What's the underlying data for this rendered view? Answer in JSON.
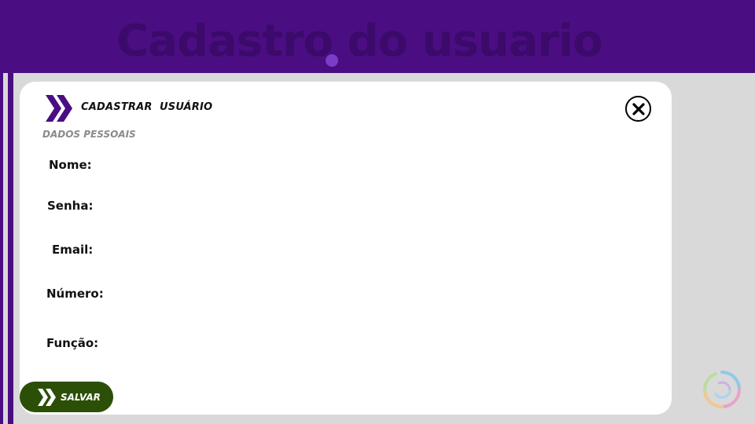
{
  "header": {
    "title": "Cadastro do usuario"
  },
  "card": {
    "title": "CADASTRAR  USUÁRIO",
    "section_label": "DADOS PESSOAIS"
  },
  "fields": [
    {
      "label": "Nome:",
      "value": ""
    },
    {
      "label": "Senha:",
      "value": ""
    },
    {
      "label": "Email:",
      "value": ""
    },
    {
      "label": "Número:",
      "value": ""
    },
    {
      "label": "Função:",
      "value": ""
    }
  ],
  "save_button": {
    "label": "SALVAR"
  },
  "icons": {
    "brand": "double-chevron-right-icon",
    "close": "close-circle-icon",
    "save": "double-chevron-right-icon",
    "logo": "rainbow-ring-logo"
  },
  "colors": {
    "primary_purple": "#4a0e82",
    "title_text_purple": "#3b0a6a",
    "save_green": "#2b4f07",
    "background": "#d9d9d9",
    "card": "#ffffff",
    "section_gray": "#8a8a8a"
  }
}
